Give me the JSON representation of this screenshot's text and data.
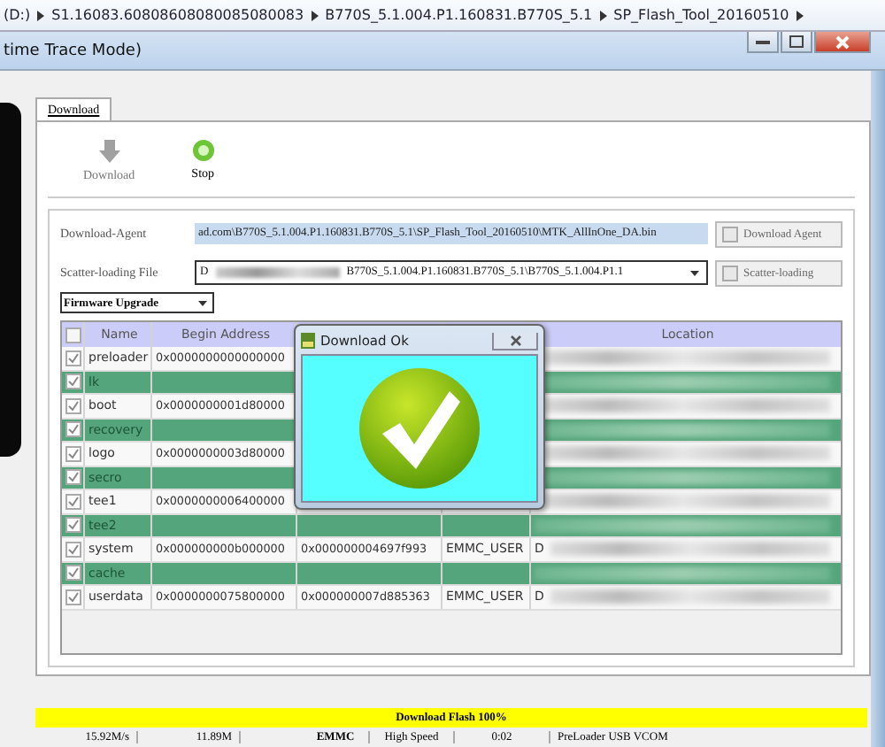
{
  "breadcrumb": [
    "(D:)",
    "S1.16083.60808608080085080083",
    "B770S_5.1.004.P1.160831.B770S_5.1",
    "SP_Flash_Tool_20160510"
  ],
  "window": {
    "title": "time Trace Mode)"
  },
  "tabs": [
    {
      "label": "Download",
      "selected": true
    }
  ],
  "toolbar": [
    {
      "label": "Download",
      "disabled": true,
      "kind": "download"
    },
    {
      "label": "Stop",
      "disabled": false,
      "kind": "stop"
    }
  ],
  "download_agent": {
    "label": "Download-Agent",
    "value": "ad.com\\B770S_5.1.004.P1.160831.B770S_5.1\\SP_Flash_Tool_20160510\\MTK_AllInOne_DA.bin",
    "button": "Download Agent"
  },
  "scatter": {
    "label": "Scatter-loading File",
    "value": "D",
    "value_end": "B770S_5.1.004.P1.160831.B770S_5.1\\B770S_5.1.004.P1.1",
    "button": "Scatter-loading"
  },
  "mode": {
    "value": "Firmware Upgrade"
  },
  "table": {
    "header": {
      "all_checked": false,
      "name": "Name",
      "begin": "Begin Address",
      "location": "Location"
    },
    "rows": [
      {
        "checked": true,
        "selected": false,
        "name": "preloader",
        "begin": "0x0000000000000000"
      },
      {
        "checked": true,
        "selected": true,
        "name": "lk"
      },
      {
        "checked": true,
        "selected": false,
        "name": "boot",
        "begin": "0x0000000001d80000"
      },
      {
        "checked": true,
        "selected": true,
        "name": "recovery"
      },
      {
        "checked": true,
        "selected": false,
        "name": "logo",
        "begin": "0x0000000003d80000"
      },
      {
        "checked": true,
        "selected": true,
        "name": "secro"
      },
      {
        "checked": true,
        "selected": false,
        "name": "tee1",
        "begin": "0x0000000006400000"
      },
      {
        "checked": true,
        "selected": true,
        "name": "tee2"
      },
      {
        "checked": true,
        "selected": false,
        "name": "system",
        "begin": "0x000000000b000000",
        "end": "0x000000004697f993",
        "region": "EMMC_USER",
        "location": "D"
      },
      {
        "checked": true,
        "selected": true,
        "name": "cache"
      },
      {
        "checked": true,
        "selected": false,
        "name": "userdata",
        "begin": "0x0000000075800000",
        "end": "0x000000007d885363",
        "region": "EMMC_USER",
        "location": "D"
      }
    ]
  },
  "dialog": {
    "title": "Download Ok"
  },
  "progress": {
    "label": "Download Flash 100%",
    "level": 1
  },
  "status": [
    "15.92M/s",
    "11.89M",
    "EMMC",
    "High Speed",
    "0:02",
    "PreLoader USB VCOM"
  ]
}
